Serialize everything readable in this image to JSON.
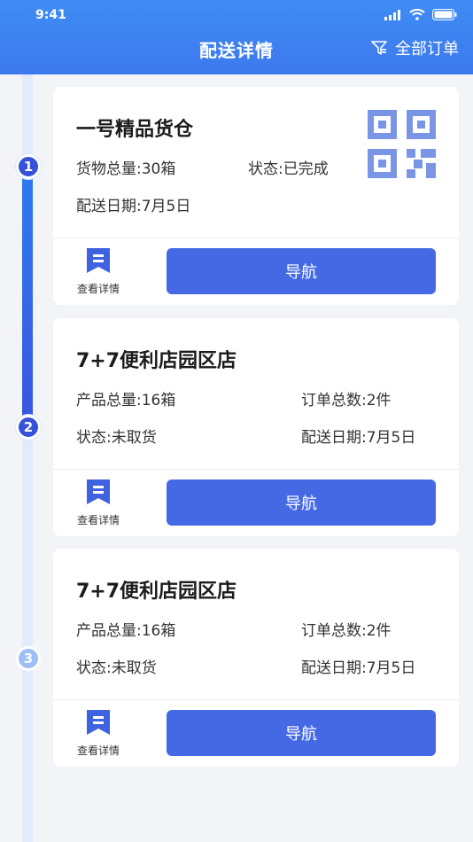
{
  "status_bar": {
    "time": "9:41"
  },
  "header": {
    "title": "配送详情",
    "filter_label": "全部订单"
  },
  "timeline": {
    "nodes": [
      "1",
      "2",
      "3"
    ]
  },
  "cards": [
    {
      "name": "一号精品货仓",
      "total": "货物总量:30箱",
      "status": "状态:已完成",
      "date": "配送日期:7月5日",
      "detail_label": "查看详情",
      "nav_label": "导航"
    },
    {
      "name": "7+7便利店园区店",
      "total": "产品总量:16箱",
      "orders": "订单总数:2件",
      "status": "状态:未取货",
      "date": "配送日期:7月5日",
      "detail_label": "查看详情",
      "nav_label": "导航"
    },
    {
      "name": "7+7便利店园区店",
      "total": "产品总量:16箱",
      "orders": "订单总数:2件",
      "status": "状态:未取货",
      "date": "配送日期:7月5日",
      "detail_label": "查看详情",
      "nav_label": "导航"
    }
  ],
  "colors": {
    "header": "#3d7ff0",
    "primary_button": "#4569e5",
    "timeline_active": "#3652d9",
    "timeline_inactive": "#9cc0f5",
    "qr": "#7b95e6"
  },
  "icons": [
    "signal-icon",
    "wifi-icon",
    "battery-icon",
    "filter-icon",
    "document-bookmark-icon",
    "qr-code-icon"
  ]
}
